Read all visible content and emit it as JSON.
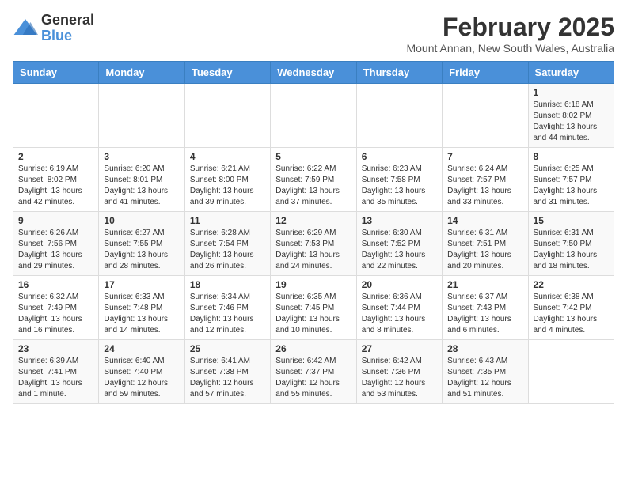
{
  "logo": {
    "general": "General",
    "blue": "Blue"
  },
  "header": {
    "month_year": "February 2025",
    "location": "Mount Annan, New South Wales, Australia"
  },
  "weekdays": [
    "Sunday",
    "Monday",
    "Tuesday",
    "Wednesday",
    "Thursday",
    "Friday",
    "Saturday"
  ],
  "weeks": [
    [
      {
        "day": "",
        "info": ""
      },
      {
        "day": "",
        "info": ""
      },
      {
        "day": "",
        "info": ""
      },
      {
        "day": "",
        "info": ""
      },
      {
        "day": "",
        "info": ""
      },
      {
        "day": "",
        "info": ""
      },
      {
        "day": "1",
        "info": "Sunrise: 6:18 AM\nSunset: 8:02 PM\nDaylight: 13 hours and 44 minutes."
      }
    ],
    [
      {
        "day": "2",
        "info": "Sunrise: 6:19 AM\nSunset: 8:02 PM\nDaylight: 13 hours and 42 minutes."
      },
      {
        "day": "3",
        "info": "Sunrise: 6:20 AM\nSunset: 8:01 PM\nDaylight: 13 hours and 41 minutes."
      },
      {
        "day": "4",
        "info": "Sunrise: 6:21 AM\nSunset: 8:00 PM\nDaylight: 13 hours and 39 minutes."
      },
      {
        "day": "5",
        "info": "Sunrise: 6:22 AM\nSunset: 7:59 PM\nDaylight: 13 hours and 37 minutes."
      },
      {
        "day": "6",
        "info": "Sunrise: 6:23 AM\nSunset: 7:58 PM\nDaylight: 13 hours and 35 minutes."
      },
      {
        "day": "7",
        "info": "Sunrise: 6:24 AM\nSunset: 7:57 PM\nDaylight: 13 hours and 33 minutes."
      },
      {
        "day": "8",
        "info": "Sunrise: 6:25 AM\nSunset: 7:57 PM\nDaylight: 13 hours and 31 minutes."
      }
    ],
    [
      {
        "day": "9",
        "info": "Sunrise: 6:26 AM\nSunset: 7:56 PM\nDaylight: 13 hours and 29 minutes."
      },
      {
        "day": "10",
        "info": "Sunrise: 6:27 AM\nSunset: 7:55 PM\nDaylight: 13 hours and 28 minutes."
      },
      {
        "day": "11",
        "info": "Sunrise: 6:28 AM\nSunset: 7:54 PM\nDaylight: 13 hours and 26 minutes."
      },
      {
        "day": "12",
        "info": "Sunrise: 6:29 AM\nSunset: 7:53 PM\nDaylight: 13 hours and 24 minutes."
      },
      {
        "day": "13",
        "info": "Sunrise: 6:30 AM\nSunset: 7:52 PM\nDaylight: 13 hours and 22 minutes."
      },
      {
        "day": "14",
        "info": "Sunrise: 6:31 AM\nSunset: 7:51 PM\nDaylight: 13 hours and 20 minutes."
      },
      {
        "day": "15",
        "info": "Sunrise: 6:31 AM\nSunset: 7:50 PM\nDaylight: 13 hours and 18 minutes."
      }
    ],
    [
      {
        "day": "16",
        "info": "Sunrise: 6:32 AM\nSunset: 7:49 PM\nDaylight: 13 hours and 16 minutes."
      },
      {
        "day": "17",
        "info": "Sunrise: 6:33 AM\nSunset: 7:48 PM\nDaylight: 13 hours and 14 minutes."
      },
      {
        "day": "18",
        "info": "Sunrise: 6:34 AM\nSunset: 7:46 PM\nDaylight: 13 hours and 12 minutes."
      },
      {
        "day": "19",
        "info": "Sunrise: 6:35 AM\nSunset: 7:45 PM\nDaylight: 13 hours and 10 minutes."
      },
      {
        "day": "20",
        "info": "Sunrise: 6:36 AM\nSunset: 7:44 PM\nDaylight: 13 hours and 8 minutes."
      },
      {
        "day": "21",
        "info": "Sunrise: 6:37 AM\nSunset: 7:43 PM\nDaylight: 13 hours and 6 minutes."
      },
      {
        "day": "22",
        "info": "Sunrise: 6:38 AM\nSunset: 7:42 PM\nDaylight: 13 hours and 4 minutes."
      }
    ],
    [
      {
        "day": "23",
        "info": "Sunrise: 6:39 AM\nSunset: 7:41 PM\nDaylight: 13 hours and 1 minute."
      },
      {
        "day": "24",
        "info": "Sunrise: 6:40 AM\nSunset: 7:40 PM\nDaylight: 12 hours and 59 minutes."
      },
      {
        "day": "25",
        "info": "Sunrise: 6:41 AM\nSunset: 7:38 PM\nDaylight: 12 hours and 57 minutes."
      },
      {
        "day": "26",
        "info": "Sunrise: 6:42 AM\nSunset: 7:37 PM\nDaylight: 12 hours and 55 minutes."
      },
      {
        "day": "27",
        "info": "Sunrise: 6:42 AM\nSunset: 7:36 PM\nDaylight: 12 hours and 53 minutes."
      },
      {
        "day": "28",
        "info": "Sunrise: 6:43 AM\nSunset: 7:35 PM\nDaylight: 12 hours and 51 minutes."
      },
      {
        "day": "",
        "info": ""
      }
    ]
  ]
}
